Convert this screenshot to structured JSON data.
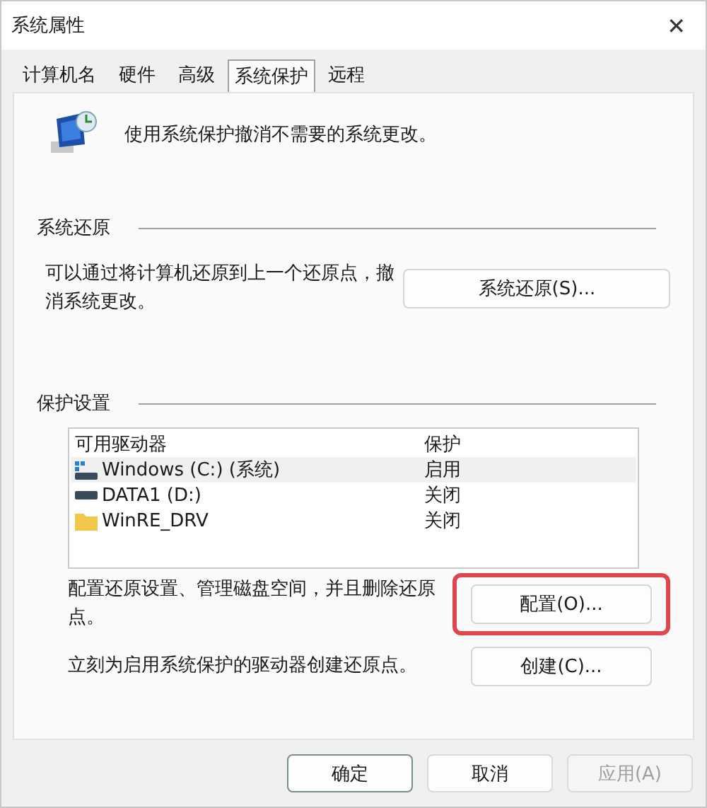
{
  "window": {
    "title": "系统属性",
    "close": "✕"
  },
  "tabs": [
    {
      "label": "计算机名",
      "selected": false
    },
    {
      "label": "硬件",
      "selected": false
    },
    {
      "label": "高级",
      "selected": false
    },
    {
      "label": "系统保护",
      "selected": true
    },
    {
      "label": "远程",
      "selected": false
    }
  ],
  "intro": "使用系统保护撤消不需要的系统更改。",
  "restore": {
    "heading": "系统还原",
    "text": "可以通过将计算机还原到上一个还原点，撤消系统更改。",
    "button": "系统还原(S)..."
  },
  "protection": {
    "heading": "保护设置",
    "columns": [
      "可用驱动器",
      "保护"
    ],
    "drives": [
      {
        "name": "Windows (C:) (系统)",
        "status": "启用",
        "kind": "system",
        "selected": true
      },
      {
        "name": "DATA1 (D:)",
        "status": "关闭",
        "kind": "drive",
        "selected": false
      },
      {
        "name": "WinRE_DRV",
        "status": "关闭",
        "kind": "folder",
        "selected": false
      }
    ],
    "actions": [
      {
        "text": "配置还原设置、管理磁盘空间，并且删除还原点。",
        "button": "配置(O)...",
        "highlighted": true
      },
      {
        "text": "立刻为启用系统保护的驱动器创建还原点。",
        "button": "创建(C)...",
        "highlighted": false
      }
    ]
  },
  "footer": [
    {
      "label": "确定",
      "disabled": false,
      "default": true
    },
    {
      "label": "取消",
      "disabled": false,
      "default": false
    },
    {
      "label": "应用(A)",
      "disabled": true,
      "default": false
    }
  ]
}
